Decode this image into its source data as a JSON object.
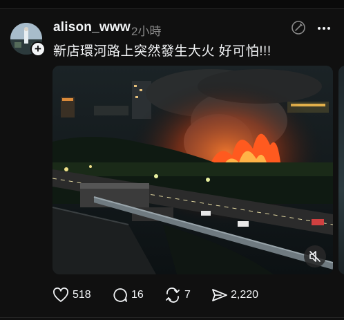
{
  "post": {
    "username": "alison_www",
    "time": "2小時",
    "text": "新店環河路上突然發生大火 好可怕!!!",
    "follow_badge": "+"
  },
  "actions": {
    "likes": "518",
    "replies": "16",
    "reposts": "7",
    "shares": "2,220"
  },
  "icons": {
    "like": "heart-icon",
    "reply": "comment-icon",
    "repost": "repost-icon",
    "share": "send-icon",
    "more": "more-icon",
    "edit": "edit-icon",
    "mute": "muted-speaker-icon"
  },
  "colors": {
    "background": "#101010",
    "text": "#f3f5f7",
    "secondary_text": "#8a8a8a",
    "fire": "#ff5a1f"
  }
}
